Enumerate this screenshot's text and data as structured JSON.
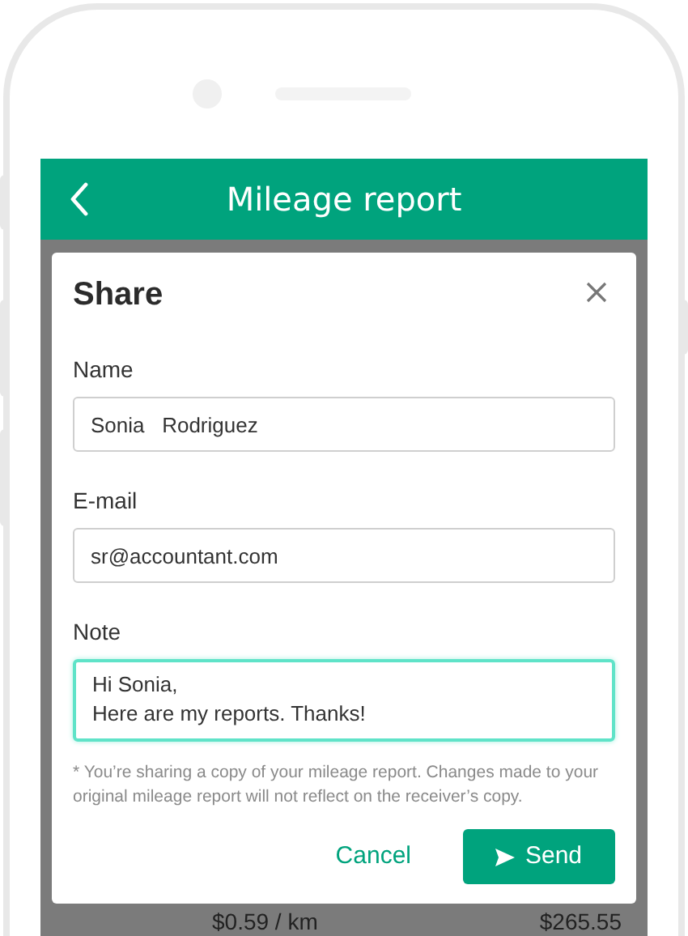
{
  "app_bar": {
    "title": "Mileage report"
  },
  "background_row": {
    "rate": "$0.59 / km",
    "amount": "$265.55"
  },
  "dialog": {
    "title": "Share",
    "fields": [
      {
        "label": "Name",
        "value": "Sonia   Rodriguez",
        "focused": false,
        "kind": "line"
      },
      {
        "label": "E-mail",
        "value": "sr@accountant.com",
        "focused": false,
        "kind": "line"
      },
      {
        "label": "Note",
        "value": "Hi Sonia,\nHere are my reports. Thanks!",
        "focused": true,
        "kind": "area"
      }
    ],
    "footnote": "* You’re sharing a copy of your mileage report. Changes made to your original mileage report will not reflect on the receiver’s copy.",
    "buttons": [
      {
        "label": "Cancel",
        "kind": "text"
      },
      {
        "label": "Send",
        "kind": "primary"
      }
    ]
  }
}
